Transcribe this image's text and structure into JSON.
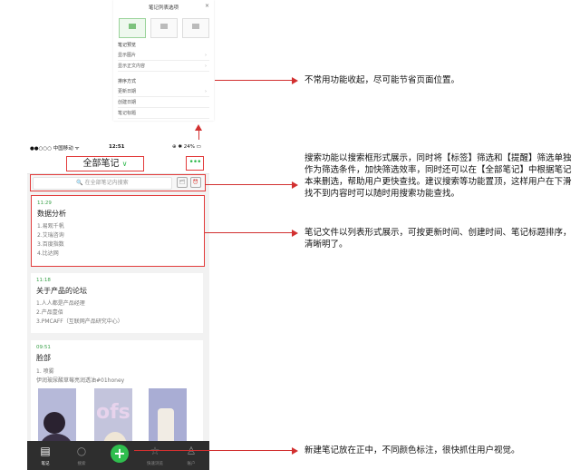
{
  "popup": {
    "title": "笔记列表选项",
    "close": "×",
    "view_options": [
      "≡≡",
      "⊞",
      "▤"
    ],
    "view_labels": [
      "A",
      "B",
      "C"
    ],
    "section1": "笔记预览",
    "rows1": [
      "显示图片",
      "显示正文内容"
    ],
    "section2": "排序方式",
    "rows2": [
      "更新日期",
      "创建日期",
      "笔记标题"
    ]
  },
  "phone": {
    "status": {
      "carrier": "●●○○○ 中国移动 ᯤ",
      "time": "12:51",
      "battery": "⊕ ✱ 24% ▭"
    },
    "nav_title": "全部笔记",
    "nav_caret": "∨",
    "more": "•••",
    "search_placeholder": "🔍 在全部笔记内搜索",
    "search_icons": [
      "🗂",
      "⏰"
    ],
    "notes": [
      {
        "time": "11:29",
        "title": "数据分析",
        "lines": [
          "1.易观千帆",
          "2.艾瑞咨询",
          "3.百度指数",
          "4.比达网"
        ]
      },
      {
        "time": "11:18",
        "title": "关于产品的论坛",
        "lines": [
          "1.人人都是产品经理",
          "2.产品壹佰",
          "3.PMCAFF（互联网产品研究中心）"
        ]
      },
      {
        "time": "09:51",
        "title": "脸部",
        "lines": [
          "1. 喷雾",
          "伊润玻尿酸草莓亮润透油#01honey"
        ]
      }
    ],
    "tabs": [
      {
        "icon": "▤",
        "label": "笔记"
      },
      {
        "icon": "○",
        "label": "搜索"
      },
      {
        "icon": "☆",
        "label": "快速浏览"
      },
      {
        "icon": "♙",
        "label": "账户"
      }
    ],
    "add_icon": "+"
  },
  "annotations": {
    "a1": "不常用功能收起，尽可能节省页面位置。",
    "a2": "搜索功能以搜索框形式展示，同时将【标签】筛选和【提醒】筛选单独作为筛选条件，加快筛选效率，同时还可以在【全部笔记】中根据笔记本来删选，帮助用户更快查找。建议搜索等功能置顶，这样用户在下滑找不到内容时可以随时用搜索功能查找。",
    "a3": "笔记文件以列表形式展示，可按更新时间、创建时间、笔记标题排序，清晰明了。",
    "a4": "新建笔记放在正中，不同颜色标注，很快抓住用户视觉。"
  },
  "colors": {
    "accent_green": "#2fb94c",
    "highlight_red": "#e23b3b",
    "tabbar_bg": "#2e2e2e"
  }
}
